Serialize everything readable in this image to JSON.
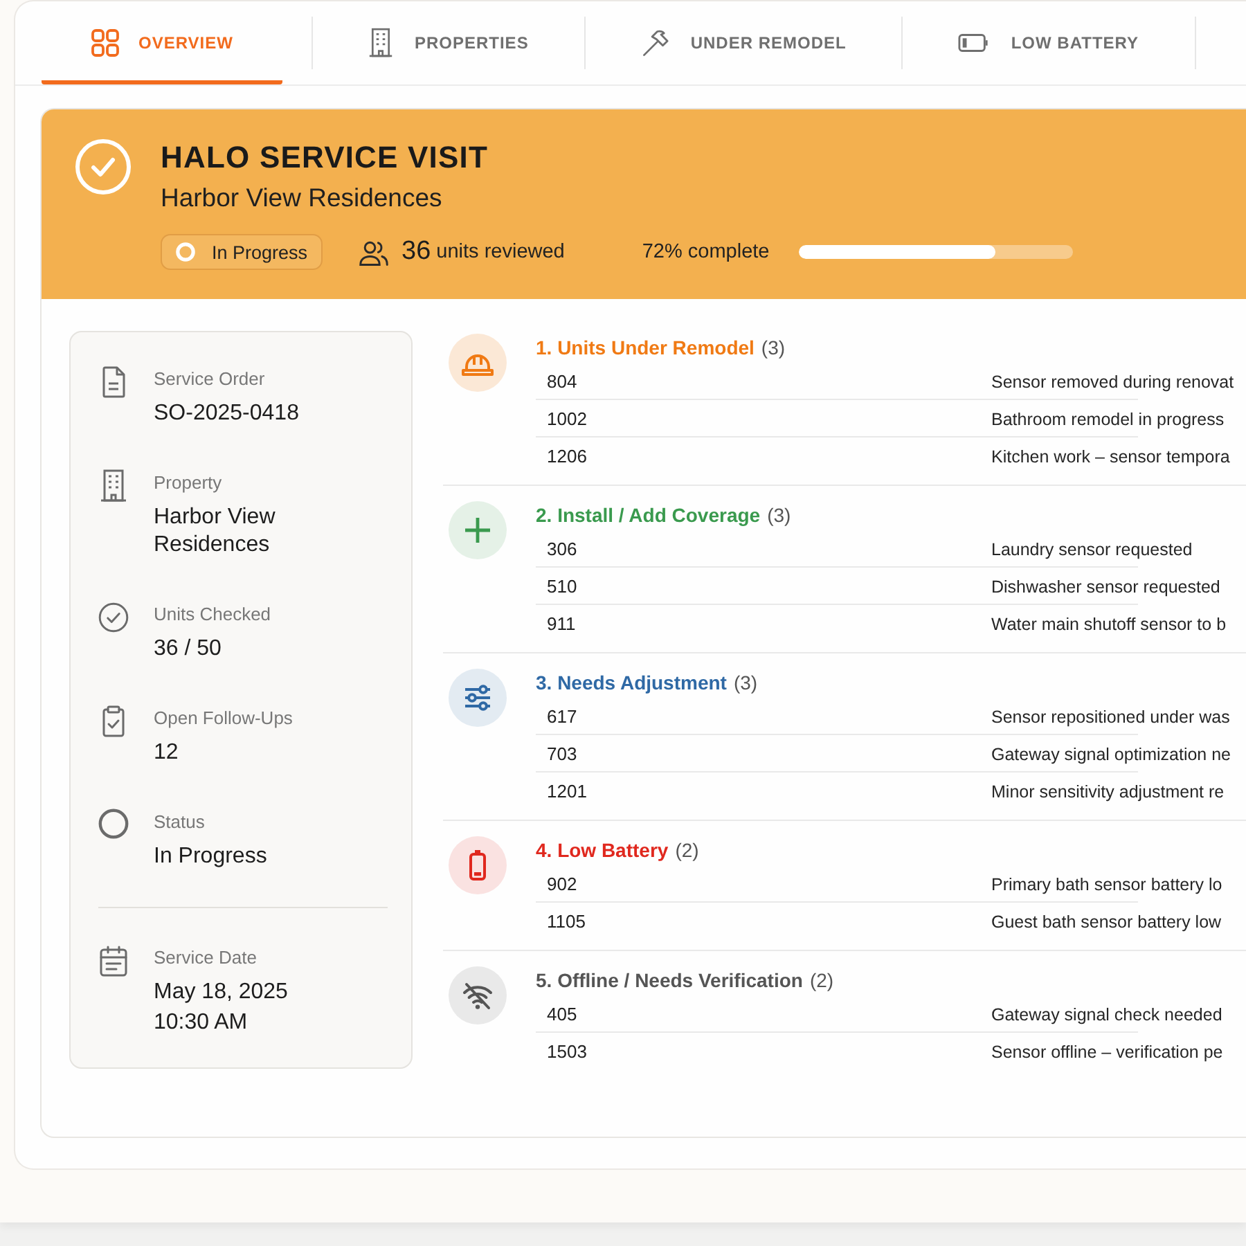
{
  "tabs": [
    {
      "label": "OVERVIEW",
      "selected": true
    },
    {
      "label": "PROPERTIES",
      "selected": false
    },
    {
      "label": "UNDER REMODEL",
      "selected": false
    },
    {
      "label": "LOW BATTERY",
      "selected": false
    }
  ],
  "header": {
    "title": "HALO SERVICE VISIT",
    "subtitle": "Harbor View Residences",
    "status": "In Progress",
    "reviewed_count": "36",
    "reviewed_label": "units reviewed",
    "progress": {
      "label": "72% complete",
      "level": 0.72
    }
  },
  "details": [
    {
      "label": "Service Order",
      "value": "SO-2025-0418"
    },
    {
      "label": "Property",
      "value": "Harbor View Residences"
    },
    {
      "label": "Units Checked",
      "value": "36 / 50"
    },
    {
      "label": "Open Follow-Ups",
      "value": "12"
    },
    {
      "label": "Status",
      "value": "In Progress"
    },
    {
      "label": "Service Date",
      "value": "May 18, 2025",
      "time": "10:30 AM"
    }
  ],
  "sections": [
    {
      "kind": "remodel",
      "title": "1. Units Under Remodel",
      "count": "(3)",
      "color": "#f07a14",
      "rows": [
        {
          "unit": "804",
          "note": "Sensor removed during renovat"
        },
        {
          "unit": "1002",
          "note": "Bathroom remodel in progress"
        },
        {
          "unit": "1206",
          "note": "Kitchen work – sensor tempora"
        }
      ]
    },
    {
      "kind": "install",
      "title": "2. Install / Add Coverage",
      "count": "(3)",
      "color": "#3a9a4e",
      "rows": [
        {
          "unit": "306",
          "note": "Laundry sensor requested"
        },
        {
          "unit": "510",
          "note": "Dishwasher sensor requested"
        },
        {
          "unit": "911",
          "note": "Water main shutoff sensor to b"
        }
      ]
    },
    {
      "kind": "adjust",
      "title": "3. Needs Adjustment",
      "count": "(3)",
      "color": "#2f69a5",
      "rows": [
        {
          "unit": "617",
          "note": "Sensor repositioned under was"
        },
        {
          "unit": "703",
          "note": "Gateway signal optimization ne"
        },
        {
          "unit": "1201",
          "note": "Minor sensitivity adjustment re"
        }
      ]
    },
    {
      "kind": "battery",
      "title": "4. Low Battery",
      "count": "(2)",
      "color": "#e0281e",
      "rows": [
        {
          "unit": "902",
          "note": "Primary bath sensor battery lo"
        },
        {
          "unit": "1105",
          "note": "Guest bath sensor battery low"
        }
      ]
    },
    {
      "kind": "offline",
      "title": "5. Offline / Needs Verification",
      "count": "(2)",
      "color": "#555555",
      "rows": [
        {
          "unit": "405",
          "note": "Gateway signal check needed"
        },
        {
          "unit": "1503",
          "note": "Sensor offline – verification pe"
        }
      ]
    }
  ]
}
